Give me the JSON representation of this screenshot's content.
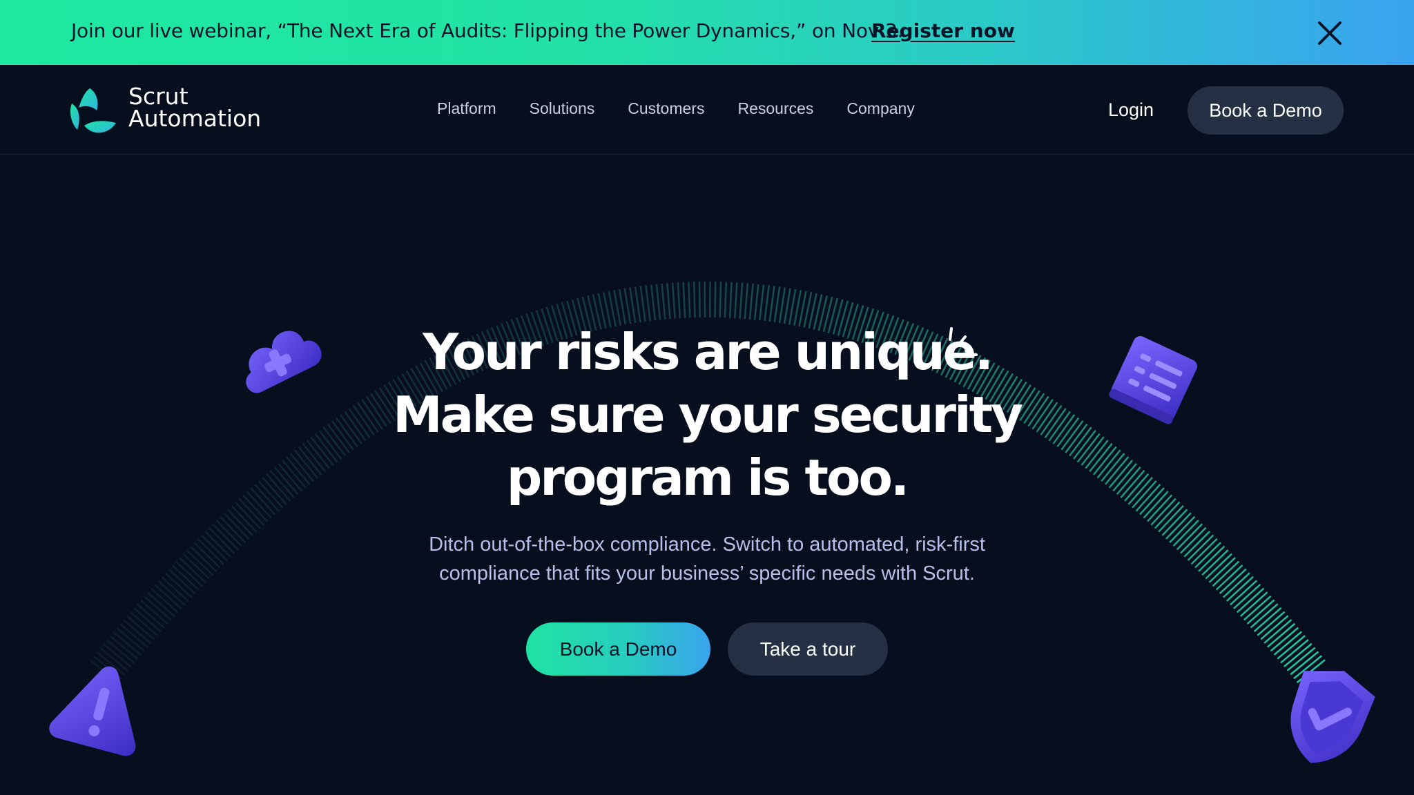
{
  "announcement": {
    "text": "Join our live webinar, “The Next Era of Audits: Flipping the Power Dynamics,” on Nov 3.",
    "link_label": "Register now"
  },
  "brand": {
    "line1": "Scrut",
    "line2": "Automation"
  },
  "nav": {
    "links": [
      "Platform",
      "Solutions",
      "Customers",
      "Resources",
      "Company"
    ],
    "login_label": "Login",
    "demo_label": "Book a Demo"
  },
  "hero": {
    "title_lines": [
      "Your risks are unique.",
      "Make sure your security",
      "program is too."
    ],
    "subtitle_lines": [
      "Ditch out-of-the-box compliance. Switch to automated, risk-first",
      "compliance that fits your business’ specific needs with Scrut."
    ],
    "primary_cta": "Book a Demo",
    "secondary_cta": "Take a tour"
  },
  "colors": {
    "background": "#070f1f",
    "accent_green": "#1de9a0",
    "accent_blue": "#3aa3f0",
    "icon_purple": "#5b46e0"
  },
  "icons": [
    "close-icon",
    "scrut-logo-icon",
    "cloud-plus-icon",
    "document-list-icon",
    "warning-icon",
    "shield-check-icon",
    "sparkle-icon"
  ]
}
